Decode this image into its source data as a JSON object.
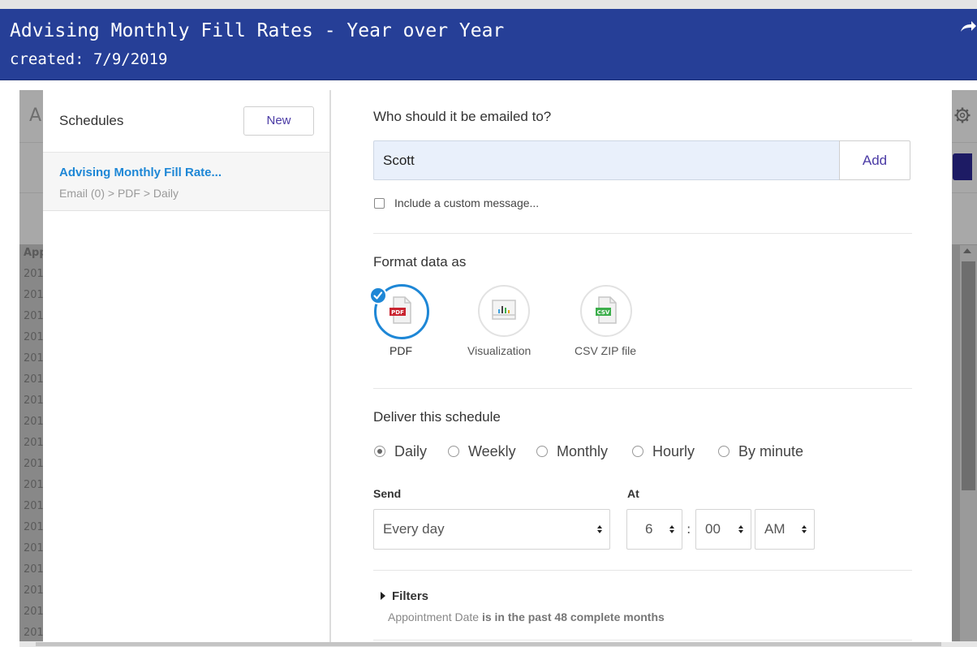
{
  "header": {
    "title": "Advising Monthly Fill Rates - Year over Year",
    "subtitle": "created: 7/9/2019"
  },
  "background": {
    "page_letter": "A",
    "column_header": "App",
    "rows": [
      "201",
      "201",
      "201",
      "201",
      "201",
      "201",
      "201",
      "201",
      "201",
      "201",
      "201",
      "201",
      "201",
      "201",
      "201",
      "201",
      "201",
      "201"
    ]
  },
  "schedules": {
    "title": "Schedules",
    "new_label": "New",
    "items": [
      {
        "name": "Advising Monthly Fill Rate...",
        "path": "Email (0) > PDF > Daily"
      }
    ]
  },
  "email": {
    "question": "Who should it be emailed to?",
    "value": "Scott",
    "add_label": "Add",
    "custom_message_label": "Include a custom message..."
  },
  "format": {
    "title": "Format data as",
    "options": [
      {
        "label": "PDF",
        "badge": "PDF",
        "selected": true
      },
      {
        "label": "Visualization",
        "selected": false
      },
      {
        "label": "CSV ZIP file",
        "badge": "CSV",
        "selected": false
      }
    ]
  },
  "deliver": {
    "title": "Deliver this schedule",
    "options": [
      "Daily",
      "Weekly",
      "Monthly",
      "Hourly",
      "By minute"
    ],
    "selected": "Daily",
    "send_label": "Send",
    "send_value": "Every day",
    "at_label": "At",
    "hour": "6",
    "minute": "00",
    "ampm": "AM",
    "separator": ":"
  },
  "filters": {
    "label": "Filters",
    "field": "Appointment Date",
    "condition": "is in the past 48 complete months"
  },
  "colors": {
    "header_bg": "#263f97",
    "accent_blue": "#1e87d6",
    "button_text": "#4a3aa5",
    "dark_button": "#1d1b64"
  }
}
